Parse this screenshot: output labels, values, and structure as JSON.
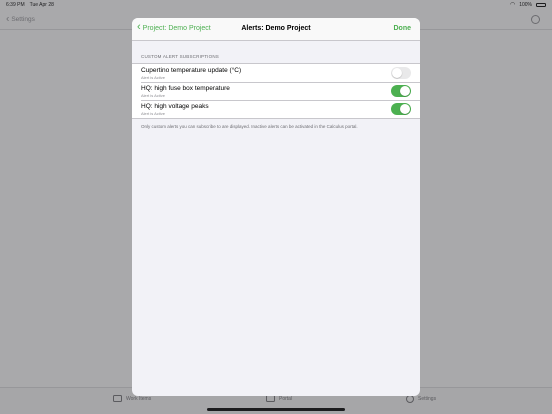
{
  "status_bar": {
    "time": "6:39 PM",
    "date": "Tue Apr 28",
    "battery": "100%"
  },
  "background": {
    "nav": {
      "back_label": "Settings",
      "title": ""
    },
    "tabs": [
      {
        "label": "Work Items"
      },
      {
        "label": "Portal"
      },
      {
        "label": "Settings"
      }
    ]
  },
  "sheet": {
    "back_label": "Project: Demo Project",
    "title": "Alerts: Demo Project",
    "done_label": "Done",
    "section_header": "CUSTOM ALERT SUBSCRIPTIONS",
    "rows": [
      {
        "name": "Cupertino temperature update (°C)",
        "status": "Alert is Active",
        "enabled": false
      },
      {
        "name": "HQ: high fuse box temperature",
        "status": "Alert is Active",
        "enabled": true
      },
      {
        "name": "HQ: high voltage peaks",
        "status": "Alert is Active",
        "enabled": true
      }
    ],
    "footer": "Only custom alerts you can subscribe to are displayed. Inactive alerts can be activated in the Calculus portal."
  },
  "colors": {
    "accent": "#4caf50",
    "toggle_on": "#4cb050",
    "toggle_off": "#e9e9ea"
  }
}
